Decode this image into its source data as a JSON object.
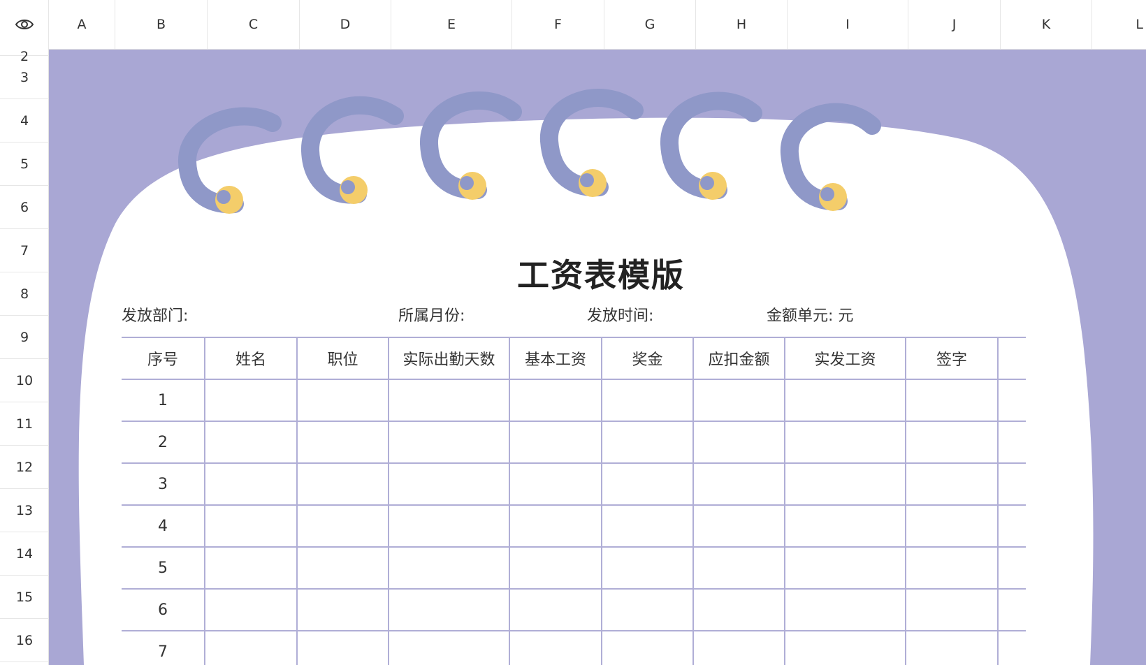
{
  "columns": [
    "A",
    "B",
    "C",
    "D",
    "E",
    "F",
    "G",
    "H",
    "I",
    "J",
    "K",
    "L"
  ],
  "rows": [
    "2",
    "3",
    "4",
    "5",
    "6",
    "7",
    "8",
    "9",
    "10",
    "11",
    "12",
    "13",
    "14",
    "15",
    "16"
  ],
  "sheet": {
    "title": "工资表模版",
    "info": {
      "dept_label": "发放部门:",
      "month_label": "所属月份:",
      "time_label": "发放时间:",
      "unit_label": "金额单元: 元"
    },
    "table": {
      "headers": [
        "序号",
        "姓名",
        "职位",
        "实际出勤天数",
        "基本工资",
        "奖金",
        "应扣金额",
        "实发工资",
        "签字",
        ""
      ],
      "row_numbers": [
        "1",
        "2",
        "3",
        "4",
        "5",
        "6",
        "7"
      ]
    }
  },
  "colors": {
    "background_purple": "#a9a7d4",
    "ring_blue": "#8f98c8",
    "ring_dot_yellow": "#f4cd6a",
    "grid_line": "#b0aed6"
  },
  "icons": {
    "visibility": "eye-icon"
  }
}
